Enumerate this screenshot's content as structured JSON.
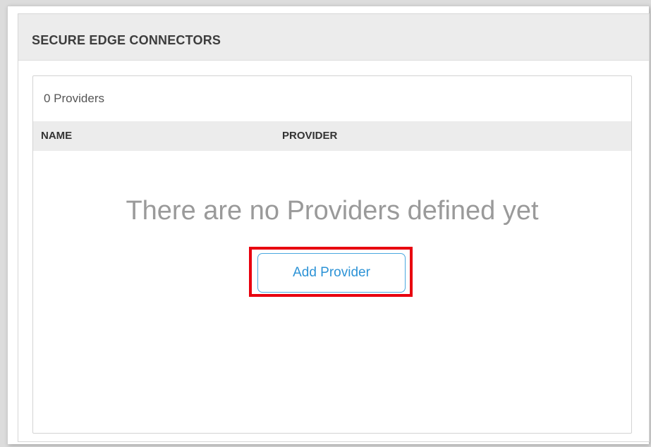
{
  "panel": {
    "title": "SECURE EDGE CONNECTORS"
  },
  "providers": {
    "count_label": "0 Providers",
    "columns": [
      "NAME",
      "PROVIDER"
    ],
    "empty_message": "There are no Providers defined yet",
    "add_button_label": "Add Provider"
  },
  "colors": {
    "accent": "#2d93d6",
    "highlight": "#e8000f",
    "header_bg": "#ececec"
  }
}
